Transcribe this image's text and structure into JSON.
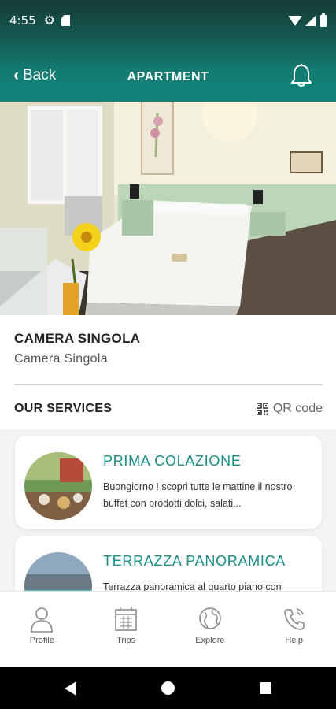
{
  "status_bar": {
    "time": "4:55"
  },
  "header": {
    "back_label": "Back",
    "title": "APARTMENT"
  },
  "room": {
    "name": "CAMERA SINGOLA",
    "subtitle": "Camera Singola"
  },
  "services": {
    "heading": "OUR SERVICES",
    "qr_label": "QR code",
    "items": [
      {
        "title": "PRIMA COLAZIONE",
        "description": "Buongiorno ! scopri tutte le mattine il nostro buffet con prodotti dolci, salati..."
      },
      {
        "title": "TERRAZZA PANORAMICA",
        "description": "Terrazza panoramica al quarto piano con accesso solo su prenotazione"
      }
    ]
  },
  "tabs": [
    {
      "label": "Profile",
      "icon": "person-icon"
    },
    {
      "label": "Trips",
      "icon": "calendar-icon"
    },
    {
      "label": "Explore",
      "icon": "globe-icon"
    },
    {
      "label": "Help",
      "icon": "phone-icon"
    }
  ],
  "colors": {
    "primary": "#12837a",
    "header_dark": "#163b37",
    "accent_text": "#1a8e86"
  }
}
